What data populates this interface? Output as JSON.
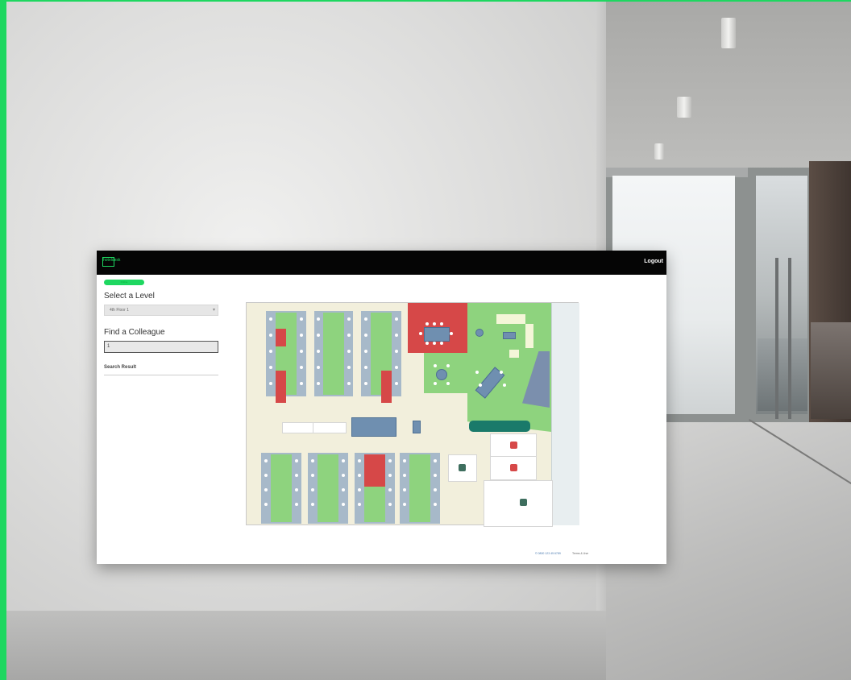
{
  "app": {
    "logo_text": "hoteldesk",
    "logout_label": "Logout",
    "status_badge": "Online"
  },
  "sidebar": {
    "level_heading": "Select a Level",
    "level_select_value": "4th Floor 1",
    "colleague_heading": "Find a Colleague",
    "colleague_input_value": "1",
    "search_result_heading": "Search Result"
  },
  "footer": {
    "phone": "© 0800 123 45 6789",
    "link": "Terms & Use"
  },
  "colors": {
    "accent": "#1ed760",
    "desk_available": "#8ed37e",
    "desk_booked": "#d64848",
    "desk_frame": "#a7b9c9",
    "table": "#6f8fb0",
    "corridor": "#f2efdc"
  },
  "icons": [
    "logo-icon",
    "chevron-down-icon",
    "restroom-icon",
    "kitchen-icon",
    "printer-icon"
  ]
}
